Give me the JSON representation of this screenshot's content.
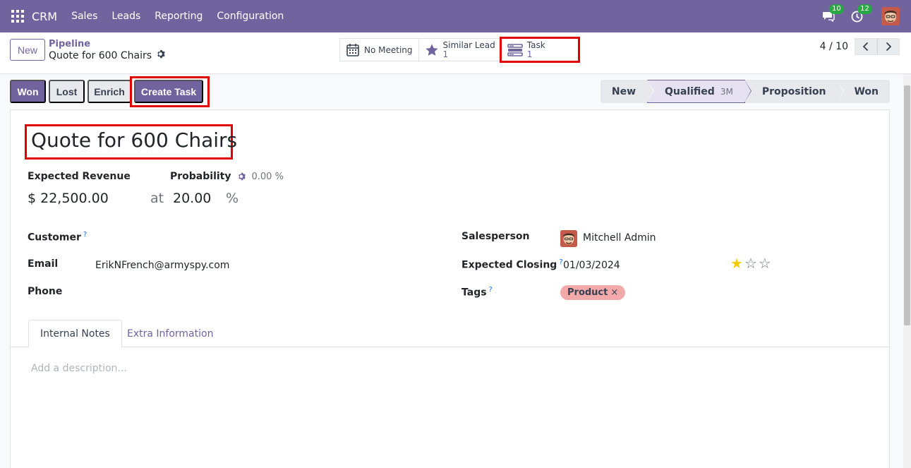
{
  "navbar": {
    "brand": "CRM",
    "menu": [
      "Sales",
      "Leads",
      "Reporting",
      "Configuration"
    ],
    "messages_badge": "10",
    "activities_badge": "12"
  },
  "control": {
    "new_label": "New",
    "breadcrumb_parent": "Pipeline",
    "breadcrumb_current": "Quote for 600 Chairs",
    "smart_buttons": {
      "meeting": {
        "label": "No Meeting"
      },
      "similar": {
        "label": "Similar Lead",
        "count": "1"
      },
      "task": {
        "label": "Task",
        "count": "1"
      }
    },
    "pager": "4 / 10"
  },
  "actions": {
    "won": "Won",
    "lost": "Lost",
    "enrich": "Enrich",
    "create_task": "Create Task"
  },
  "stages": {
    "items": [
      "New",
      "Qualified",
      "Proposition",
      "Won"
    ],
    "active": "Qualified",
    "active_duration": "3M"
  },
  "form": {
    "title": "Quote for 600 Chairs",
    "expected_revenue_label": "Expected Revenue",
    "expected_revenue": "$ 22,500.00",
    "at": "at",
    "probability_label": "Probability",
    "probability_auto": "0.00 %",
    "probability": "20.00",
    "percent": "%",
    "customer_label": "Customer",
    "email_label": "Email",
    "email": "ErikNFrench@armyspy.com",
    "phone_label": "Phone",
    "salesperson_label": "Salesperson",
    "salesperson": "Mitchell Admin",
    "closing_label": "Expected Closing",
    "closing": "01/03/2024",
    "tags_label": "Tags",
    "tag": "Product",
    "priority_stars": 1,
    "tab_notes": "Internal Notes",
    "tab_extra": "Extra Information",
    "description_placeholder": "Add a description..."
  },
  "colors": {
    "primary": "#71639e",
    "highlight": "#e00000",
    "tag": "#f2a9a9",
    "star": "#f3cc00"
  }
}
